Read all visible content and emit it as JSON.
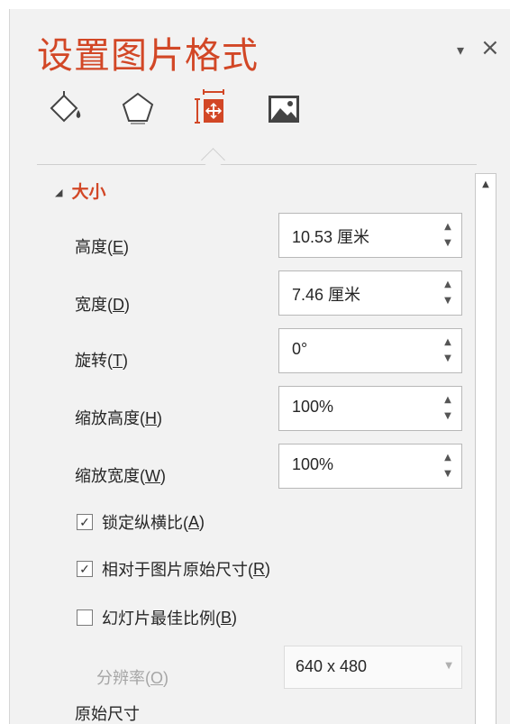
{
  "pane": {
    "title": "设置图片格式",
    "dropdown_glyph": "▾",
    "close_glyph": "×"
  },
  "tabs": [
    {
      "name": "fill-line-icon",
      "active": false
    },
    {
      "name": "effects-icon",
      "active": false
    },
    {
      "name": "size-properties-icon",
      "active": true
    },
    {
      "name": "picture-icon",
      "active": false
    }
  ],
  "section": {
    "toggle_glyph": "◢",
    "title": "大小"
  },
  "fields": {
    "height": {
      "label": "高度(",
      "key": "E",
      "suffix": ")",
      "value": "10.53 厘米"
    },
    "width": {
      "label": "宽度(",
      "key": "D",
      "suffix": ")",
      "value": "7.46 厘米"
    },
    "rotation": {
      "label": "旋转(",
      "key": "T",
      "suffix": ")",
      "value": "0°"
    },
    "scale_height": {
      "label": "缩放高度(",
      "key": "H",
      "suffix": ")",
      "value": "100%"
    },
    "scale_width": {
      "label": "缩放宽度(",
      "key": "W",
      "suffix": ")",
      "value": "100%"
    }
  },
  "checks": {
    "lock_ratio": {
      "label": "锁定纵横比(",
      "key": "A",
      "suffix": ")",
      "checked": true
    },
    "relative_original": {
      "label": "相对于图片原始尺寸(",
      "key": "R",
      "suffix": ")",
      "checked": true
    },
    "best_scale": {
      "label": "幻灯片最佳比例(",
      "key": "B",
      "suffix": ")",
      "checked": false
    }
  },
  "resolution": {
    "label": "分辨率(",
    "key": "O",
    "suffix": ")",
    "value": "640 x 480"
  },
  "original_size_label": "原始尺寸",
  "spin_up": "▲",
  "spin_down": "▼",
  "scroll_up_glyph": "▲",
  "check_glyph": "✓",
  "colors": {
    "accent": "#d24726",
    "pane_bg": "#f2f2f2"
  }
}
